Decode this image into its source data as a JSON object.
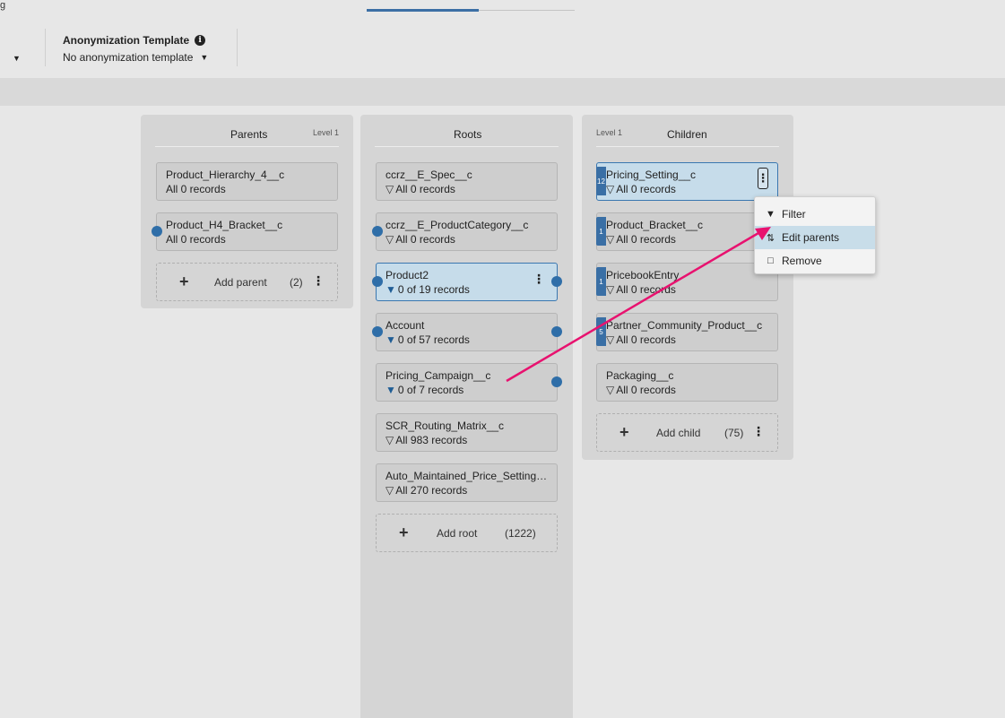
{
  "header": {
    "corner_fragment": "g",
    "anonymization_label": "Anonymization Template",
    "anonymization_value": "No anonymization template"
  },
  "parents": {
    "title": "Parents",
    "level": "Level 1",
    "cards": [
      {
        "name": "Product_Hierarchy_4__c",
        "records": "All 0 records"
      },
      {
        "name": "Product_H4_Bracket__c",
        "records": "All 0 records"
      }
    ],
    "add": {
      "label": "Add parent",
      "count": "(2)"
    }
  },
  "roots": {
    "title": "Roots",
    "cards": [
      {
        "name": "ccrz__E_Spec__c",
        "records": "All 0 records",
        "filter": "outline"
      },
      {
        "name": "ccrz__E_ProductCategory__c",
        "records": "All 0 records",
        "filter": "outline"
      },
      {
        "name": "Product2",
        "records": "0 of 19 records",
        "filter": "filled"
      },
      {
        "name": "Account",
        "records": "0 of 57 records",
        "filter": "filled"
      },
      {
        "name": "Pricing_Campaign__c",
        "records": "0 of 7 records",
        "filter": "filled"
      },
      {
        "name": "SCR_Routing_Matrix__c",
        "records": "All 983 records",
        "filter": "outline"
      },
      {
        "name": "Auto_Maintained_Price_Setting…",
        "records": "All 270 records",
        "filter": "outline"
      }
    ],
    "add": {
      "label": "Add root",
      "count": "(1222)"
    }
  },
  "children": {
    "title": "Children",
    "level": "Level 1",
    "cards": [
      {
        "name": "Pricing_Setting__c",
        "records": "All 0 records",
        "badge": "12"
      },
      {
        "name": "Product_Bracket__c",
        "records": "All 0 records",
        "badge": "1"
      },
      {
        "name": "PricebookEntry",
        "records": "All 0 records",
        "badge": "1"
      },
      {
        "name": "Partner_Community_Product__c",
        "records": "All 0 records",
        "badge": "5"
      },
      {
        "name": "Packaging__c",
        "records": "All 0 records"
      }
    ],
    "add": {
      "label": "Add child",
      "count": "(75)"
    }
  },
  "menu": {
    "items": [
      {
        "label": "Filter",
        "icon": "filter-icon"
      },
      {
        "label": "Edit parents",
        "icon": "edit-parents-icon"
      },
      {
        "label": "Remove",
        "icon": "trash-icon"
      }
    ]
  },
  "colors": {
    "accent": "#2f6ea8",
    "selected_card": "#c6dcea",
    "arrow": "#e8126f"
  }
}
